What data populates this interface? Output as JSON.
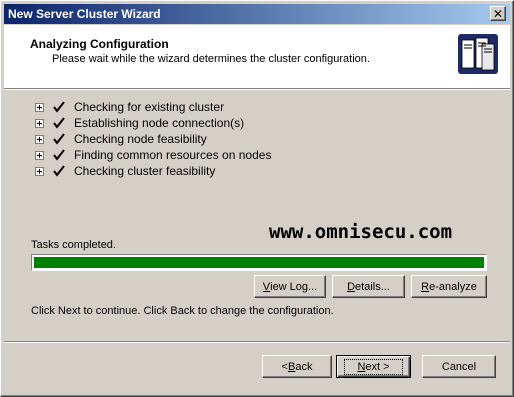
{
  "window": {
    "title": "New Server Cluster Wizard",
    "close_glyph": "✕"
  },
  "header": {
    "title": "Analyzing Configuration",
    "subtitle": "Please wait while the wizard determines the cluster configuration.",
    "icon": "server-cluster-icon"
  },
  "steps": [
    {
      "label": "Checking for existing cluster",
      "status": "done"
    },
    {
      "label": "Establishing node connection(s)",
      "status": "done"
    },
    {
      "label": "Checking node feasibility",
      "status": "done"
    },
    {
      "label": "Finding common resources on nodes",
      "status": "done"
    },
    {
      "label": "Checking cluster feasibility",
      "status": "done"
    }
  ],
  "watermark": "www.omnisecu.com",
  "progress": {
    "label": "Tasks completed.",
    "fraction": 1.0,
    "color": "#008000"
  },
  "action_buttons": {
    "view_log": {
      "pre": "",
      "mn": "V",
      "post": "iew Log..."
    },
    "details": {
      "pre": "",
      "mn": "D",
      "post": "etails..."
    },
    "reanalyze": {
      "pre": "",
      "mn": "R",
      "post": "e-analyze"
    }
  },
  "instruction": "Click Next to continue. Click Back to change the configuration.",
  "nav_buttons": {
    "back": {
      "pre": "< ",
      "mn": "B",
      "post": "ack"
    },
    "next": {
      "pre": "",
      "mn": "N",
      "post": "ext >"
    },
    "cancel": {
      "label": "Cancel"
    }
  },
  "colors": {
    "titlebar_start": "#0a246a",
    "titlebar_end": "#a6caf0",
    "face": "#d4d0c8"
  }
}
